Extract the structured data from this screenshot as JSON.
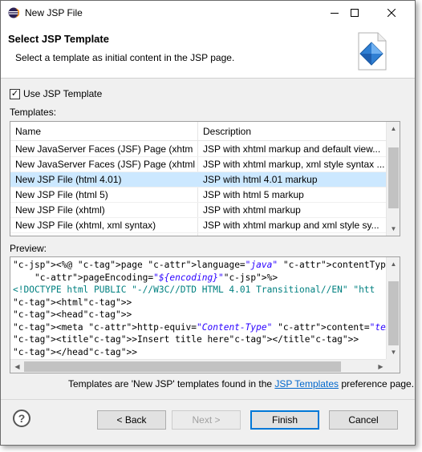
{
  "window": {
    "title": "New JSP File",
    "minimize_icon": "minimize-icon",
    "maximize_icon": "maximize-icon",
    "close_icon": "close-icon"
  },
  "header": {
    "title": "Select JSP Template",
    "description": "Select a template as initial content in the JSP page."
  },
  "use_template": {
    "label": "Use JSP Template",
    "checked": true
  },
  "templates": {
    "label": "Templates:",
    "columns": [
      "Name",
      "Description"
    ],
    "rows": [
      {
        "name": "New JavaServer Faces (JSF) Page (xhtml)",
        "description": "JSP with xhtml markup and default view..."
      },
      {
        "name": "New JavaServer Faces (JSF) Page (xhtml, ...",
        "description": "JSP with xhtml markup, xml style syntax ..."
      },
      {
        "name": "New JSP File (html 4.01)",
        "description": "JSP with html 4.01 markup"
      },
      {
        "name": "New JSP File (html 5)",
        "description": "JSP with html 5 markup"
      },
      {
        "name": "New JSP File (xhtml)",
        "description": "JSP with xhtml markup"
      },
      {
        "name": "New JSP File (xhtml, xml syntax)",
        "description": "JSP with xhtml markup and xml style sy..."
      }
    ],
    "selected_index": 2
  },
  "preview": {
    "label": "Preview:",
    "lines": [
      "<%@ page language=\"java\" contentType=\"text/html; charset=${encoding",
      "    pageEncoding=\"${encoding}\"%>",
      "<!DOCTYPE html PUBLIC \"-//W3C//DTD HTML 4.01 Transitional//EN\" \"htt",
      "<html>",
      "<head>",
      "<meta http-equiv=\"Content-Type\" content=\"text/html; charset=${encod",
      "<title>Insert title here</title>",
      "</head>"
    ]
  },
  "footer": {
    "note_before": "Templates are 'New JSP' templates found in the ",
    "link": "JSP Templates",
    "note_after": " preference page."
  },
  "buttons": {
    "back": "< Back",
    "next": "Next >",
    "finish": "Finish",
    "cancel": "Cancel"
  },
  "colors": {
    "selection": "#cce8ff",
    "default_button_border": "#0078d7",
    "link": "#0066cc"
  }
}
